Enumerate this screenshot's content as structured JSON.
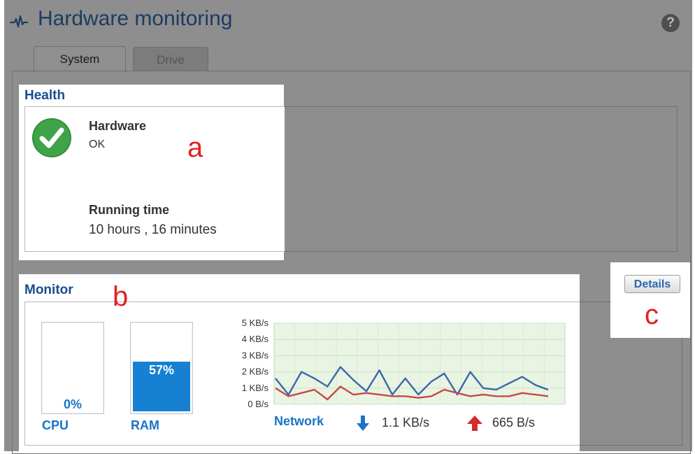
{
  "page": {
    "title": "Hardware monitoring",
    "help_symbol": "?"
  },
  "tabs": [
    {
      "label": "System",
      "active": true
    },
    {
      "label": "Drive",
      "active": false
    }
  ],
  "health": {
    "section_label": "Health",
    "status_icon": "green-check-icon",
    "hardware_label": "Hardware",
    "hardware_value": "OK",
    "running_label": "Running time",
    "running_value": "10 hours , 16 minutes"
  },
  "monitor": {
    "section_label": "Monitor",
    "cpu": {
      "label": "CPU",
      "value_text": "0%",
      "percent": 0
    },
    "ram": {
      "label": "RAM",
      "value_text": "57%",
      "percent": 57
    },
    "network": {
      "label": "Network",
      "download_icon": "arrow-down-icon",
      "download_value": "1.1 KB/s",
      "upload_icon": "arrow-up-icon",
      "upload_value": "665 B/s"
    }
  },
  "details_button": "Details",
  "annotations": {
    "a": "a",
    "b": "b",
    "c": "c"
  },
  "colors": {
    "accent_blue": "#1681d2",
    "download_line": "#3a68a8",
    "upload_line": "#c44a4a",
    "ok_green": "#3fa34a",
    "upload_arrow": "#d42a2a",
    "annotation_red": "#e12020"
  },
  "chart_data": {
    "type": "line",
    "ytick_labels": [
      "5 KB/s",
      "4 KB/s",
      "3 KB/s",
      "2 KB/s",
      "1 KB/s",
      "0 B/s"
    ],
    "ylim": [
      0,
      5
    ],
    "grid": true,
    "series": [
      {
        "values": [
          1.6,
          0.6,
          2.0,
          1.6,
          1.1,
          2.3,
          1.5,
          0.8,
          2.1,
          0.6,
          1.6,
          0.6,
          1.4,
          1.9,
          0.6,
          2.0,
          1.0,
          0.9,
          1.3,
          1.7,
          1.2,
          0.9
        ]
      },
      {
        "values": [
          1.0,
          0.5,
          0.7,
          0.9,
          0.3,
          1.1,
          0.6,
          0.7,
          0.6,
          0.5,
          0.5,
          0.4,
          0.5,
          0.9,
          0.7,
          0.5,
          0.6,
          0.5,
          0.5,
          0.7,
          0.6,
          0.5
        ]
      }
    ]
  }
}
